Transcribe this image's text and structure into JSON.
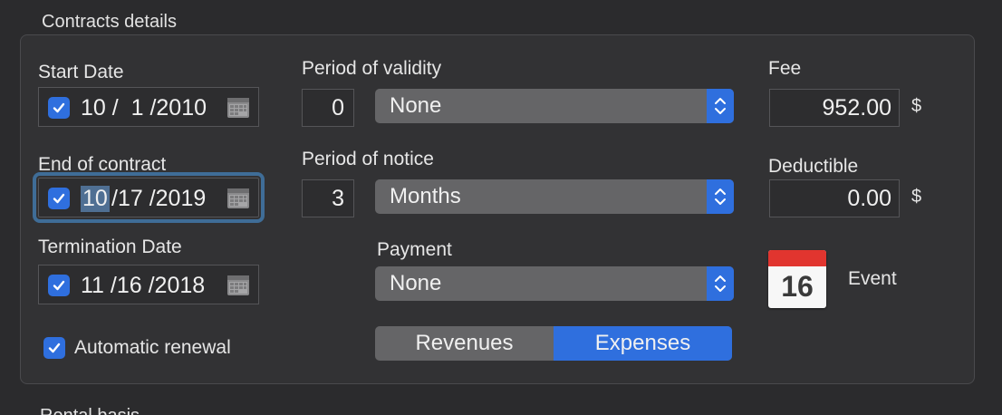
{
  "section": {
    "title": "Contracts details",
    "next_title_partial": "Rental basis"
  },
  "start_date": {
    "label": "Start Date",
    "checked": true,
    "value": "10 /  1 /2010"
  },
  "end_of_contract": {
    "label": "End of contract",
    "checked": true,
    "month": "10",
    "rest": "/17 /2019"
  },
  "termination_date": {
    "label": "Termination Date",
    "checked": true,
    "value": "11 /16 /2018"
  },
  "automatic_renewal": {
    "label": "Automatic renewal",
    "checked": true
  },
  "period_of_validity": {
    "label": "Period of validity",
    "number": "0",
    "unit": "None"
  },
  "period_of_notice": {
    "label": "Period of notice",
    "number": "3",
    "unit": "Months"
  },
  "payment": {
    "label": "Payment",
    "value": "None"
  },
  "type_toggle": {
    "options": [
      "Revenues",
      "Expenses"
    ],
    "selected": "Expenses"
  },
  "fee": {
    "label": "Fee",
    "value": "952.00",
    "currency": "$"
  },
  "deductible": {
    "label": "Deductible",
    "value": "0.00",
    "currency": "$"
  },
  "event": {
    "day": "16",
    "label": "Event"
  },
  "colors": {
    "accent": "#2f6fde",
    "focus_ring": "#3f6d97",
    "calendar_red": "#e1352f"
  }
}
